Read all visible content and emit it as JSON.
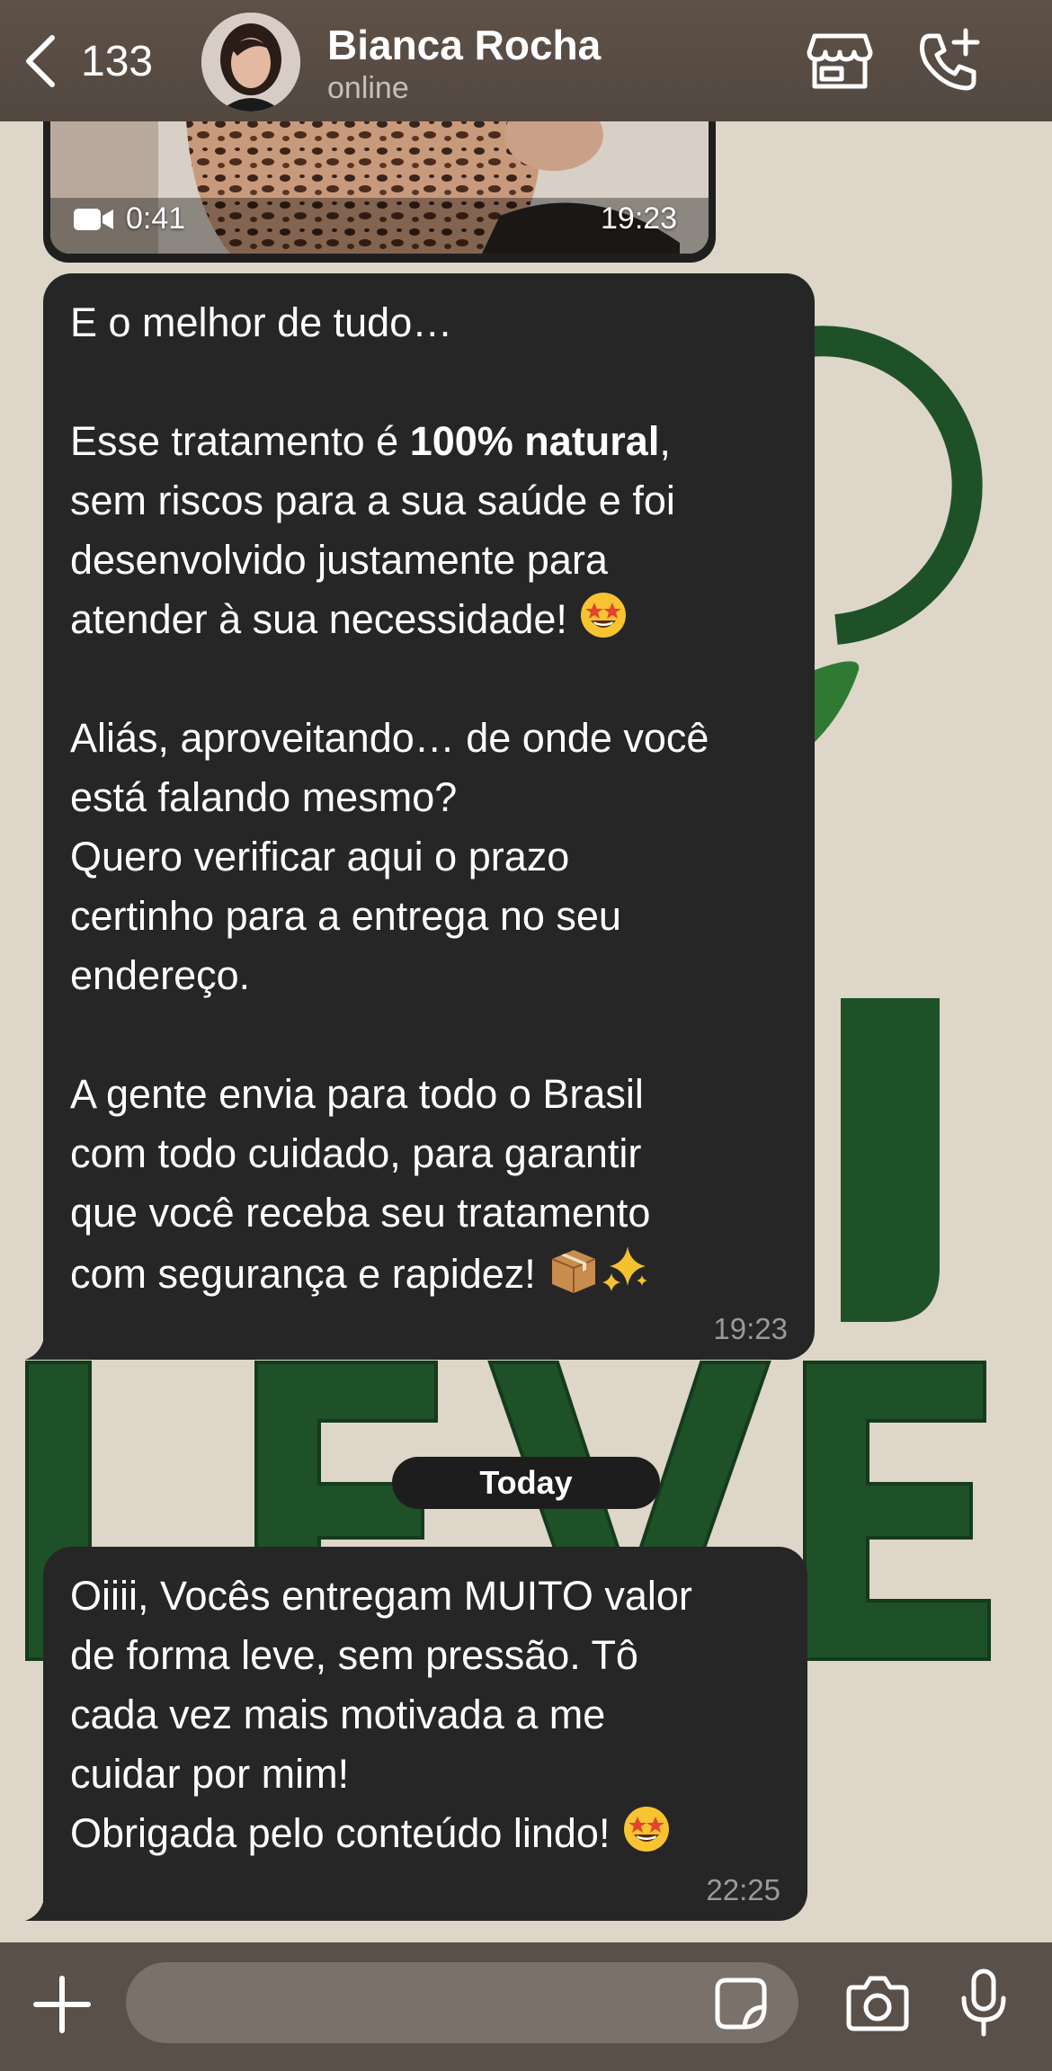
{
  "header": {
    "unread_count": "133",
    "contact_name": "Bianca Rocha",
    "contact_status": "online"
  },
  "video_message": {
    "duration": "0:41",
    "time": "19:23"
  },
  "messages": [
    {
      "time": "19:23",
      "paragraphs": {
        "p1": "E o melhor de tudo…",
        "p2_pre": "Esse tratamento é ",
        "p2_bold": "100% natural",
        "p2_post": ",\nsem riscos para a sua saúde e foi\ndesenvolvido justamente para\natender à sua necessidade! ",
        "p3": "Aliás, aproveitando… de onde você\nestá falando mesmo?\nQuero verificar aqui o prazo\ncertinho para a entrega no seu\nendereço.",
        "p4": "A gente envia para todo o Brasil\ncom todo cuidado, para garantir\nque você receba seu tratamento\ncom segurança e rapidez! "
      }
    },
    {
      "time": "22:25",
      "text": "Oiiii, Vocês entregam MUITO valor\nde forma leve, sem pressão. Tô\ncada vez mais motivada a me\ncuidar por mim!\nObrigada pelo conteúdo lindo! "
    }
  ],
  "day_separator": "Today",
  "input": {
    "placeholder": ""
  },
  "wallpaper_text": "LEVE",
  "colors": {
    "header_bg": "#5a4e45",
    "bubble_bg": "#262626",
    "wallpaper_bg": "#ddd6c9",
    "wallpaper_green": "#1e5128",
    "input_bar_bg": "#585049"
  },
  "icons": [
    "back-chevron-icon",
    "store-icon",
    "call-add-icon",
    "video-camera-icon",
    "star-struck-emoji",
    "package-emoji",
    "sparkles-emoji",
    "plus-icon",
    "sticker-icon",
    "camera-icon",
    "microphone-icon"
  ]
}
